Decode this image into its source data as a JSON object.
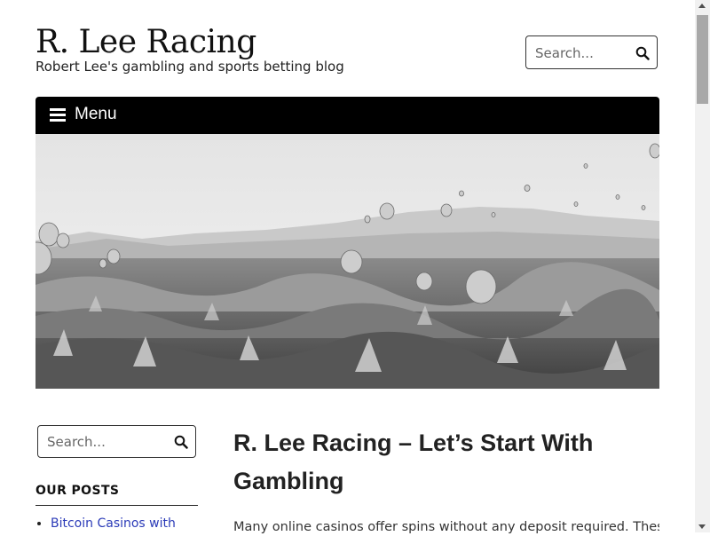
{
  "header": {
    "site_title": "R. Lee Racing",
    "tagline": "Robert Lee's gambling and sports betting blog",
    "search_placeholder": "Search..."
  },
  "nav": {
    "menu_label": "Menu"
  },
  "hero": {
    "image_alt": "hot-air-balloons-landscape"
  },
  "sidebar": {
    "search_placeholder": "Search...",
    "widget_title": "OUR POSTS",
    "posts": [
      "Bitcoin Casinos with"
    ]
  },
  "main": {
    "post_title": "R. Lee Racing – Let’s Start With Gambling",
    "excerpt": "Many online casinos offer spins without any deposit required. These"
  },
  "colors": {
    "nav_bg": "#000000",
    "link": "#2b3bb8",
    "text": "#222222"
  }
}
